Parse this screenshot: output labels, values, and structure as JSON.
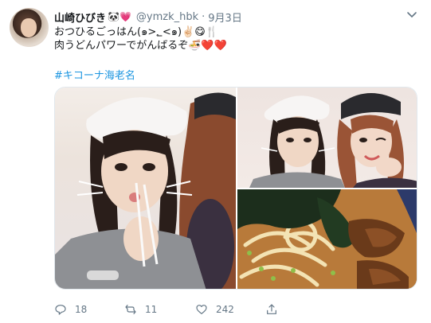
{
  "author": {
    "display_name": "山崎ひびき",
    "badge_emoji": "🐼💗",
    "handle": "@ymzk_hbk",
    "separator": "·",
    "date": "9月3日"
  },
  "tweet": {
    "line1": "おつひるごっはん(๑>؂<๑)✌🏻😋🍴",
    "line2": "肉うどんパワーでがんばるぞ🍜❤️❤️",
    "hashtag": "#キコーナ海老名"
  },
  "stats": {
    "replies": "18",
    "retweets": "11",
    "likes": "242"
  },
  "icons": [
    "avatar",
    "chevron-down-icon",
    "reply-icon",
    "retweet-icon",
    "like-icon",
    "share-icon"
  ],
  "colors": {
    "link": "#1b95e0",
    "secondary_text": "#657786",
    "primary_text": "#14171a"
  }
}
